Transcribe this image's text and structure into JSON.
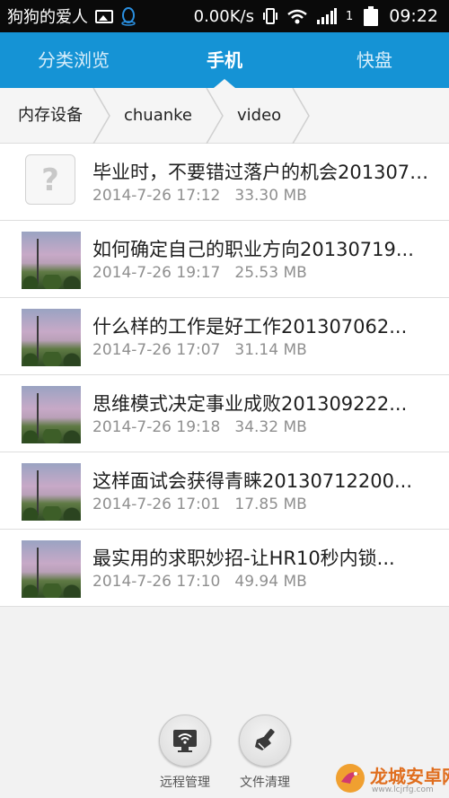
{
  "status_bar": {
    "carrier": "狗狗的爱人",
    "speed": "0.00K/s",
    "sim": "1",
    "time": "09:22"
  },
  "tabs": [
    {
      "label": "分类浏览",
      "active": false
    },
    {
      "label": "手机",
      "active": true
    },
    {
      "label": "快盘",
      "active": false
    }
  ],
  "breadcrumb": [
    "内存设备",
    "chuanke",
    "video"
  ],
  "files": [
    {
      "name": "毕业时，不要错过落户的机会2013072...",
      "date": "2014-7-26 17:12",
      "size": "33.30 MB",
      "thumb": "unknown-file-icon"
    },
    {
      "name": "如何确定自己的职业方向20130719...",
      "date": "2014-7-26 19:17",
      "size": "25.53 MB",
      "thumb": "video-thumbnail"
    },
    {
      "name": "什么样的工作是好工作201307062...",
      "date": "2014-7-26 17:07",
      "size": "31.14 MB",
      "thumb": "video-thumbnail"
    },
    {
      "name": "思维模式决定事业成败201309222...",
      "date": "2014-7-26 19:18",
      "size": "34.32 MB",
      "thumb": "video-thumbnail"
    },
    {
      "name": "这样面试会获得青睐20130712200...",
      "date": "2014-7-26 17:01",
      "size": "17.85 MB",
      "thumb": "video-thumbnail"
    },
    {
      "name": "最实用的求职妙招-让HR10秒内锁...",
      "date": "2014-7-26 17:10",
      "size": "49.94 MB",
      "thumb": "video-thumbnail"
    }
  ],
  "bottom": {
    "remote_label": "远程管理",
    "clean_label": "文件清理"
  },
  "watermark": {
    "text": "龙城安卓网",
    "sub": "www.lcjrfg.com"
  },
  "colors": {
    "accent": "#1593d5",
    "status_bar": "#0a0a0a",
    "background": "#f2f2f2"
  }
}
